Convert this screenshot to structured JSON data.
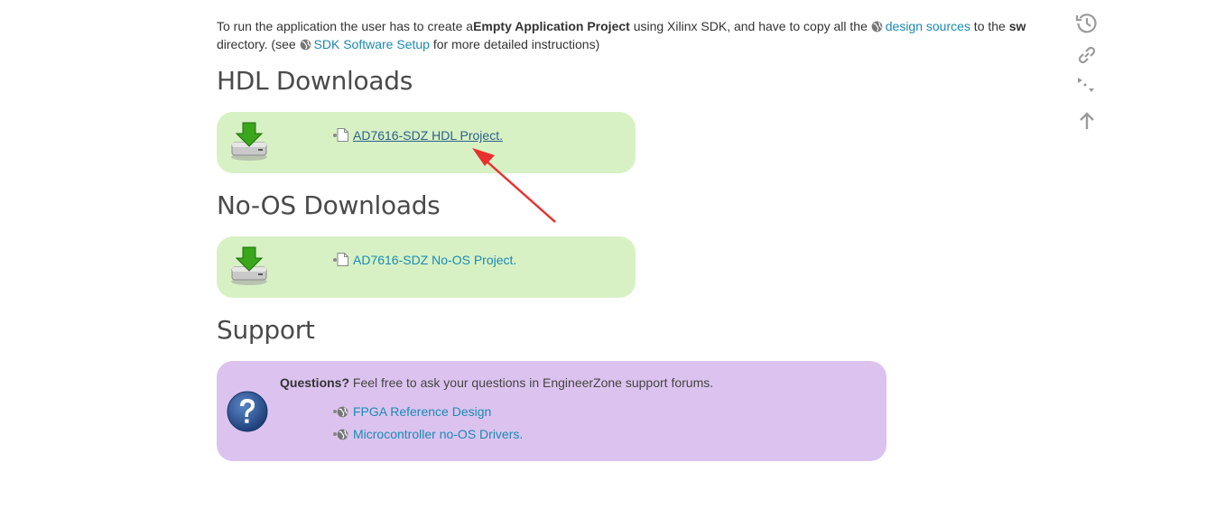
{
  "intro": {
    "part1": "To run the application the user has to create a",
    "bold1": "Empty Application Project",
    "part2": " using Xilinx SDK, and have to copy all the ",
    "link1": "design sources",
    "part3": " to the ",
    "bold2": "sw",
    "part4": " directory. (see ",
    "link2": "SDK Software Setup",
    "part5": " for more detailed instructions)"
  },
  "hdl": {
    "heading": "HDL Downloads",
    "item": "AD7616-SDZ HDL Project."
  },
  "noos": {
    "heading": "No-OS Downloads",
    "item": "AD7616-SDZ No-OS Project."
  },
  "support": {
    "heading": "Support",
    "question_bold": "Questions?",
    "question_text": " Feel free to ask your questions in EngineerZone support forums.",
    "links": [
      "FPGA Reference Design",
      "Microcontroller no-OS Drivers."
    ]
  },
  "icons": {
    "toolbar": [
      "history-icon",
      "link-icon",
      "tree-toggle-icon",
      "back-to-top-icon"
    ],
    "download": "download-drive-icon",
    "question": "question-mark-icon"
  },
  "colors": {
    "link": "#1b8ab2",
    "green_box": "#d7f1c4",
    "purple_box": "#dcc3ef",
    "annotation_arrow": "#e8302e"
  }
}
